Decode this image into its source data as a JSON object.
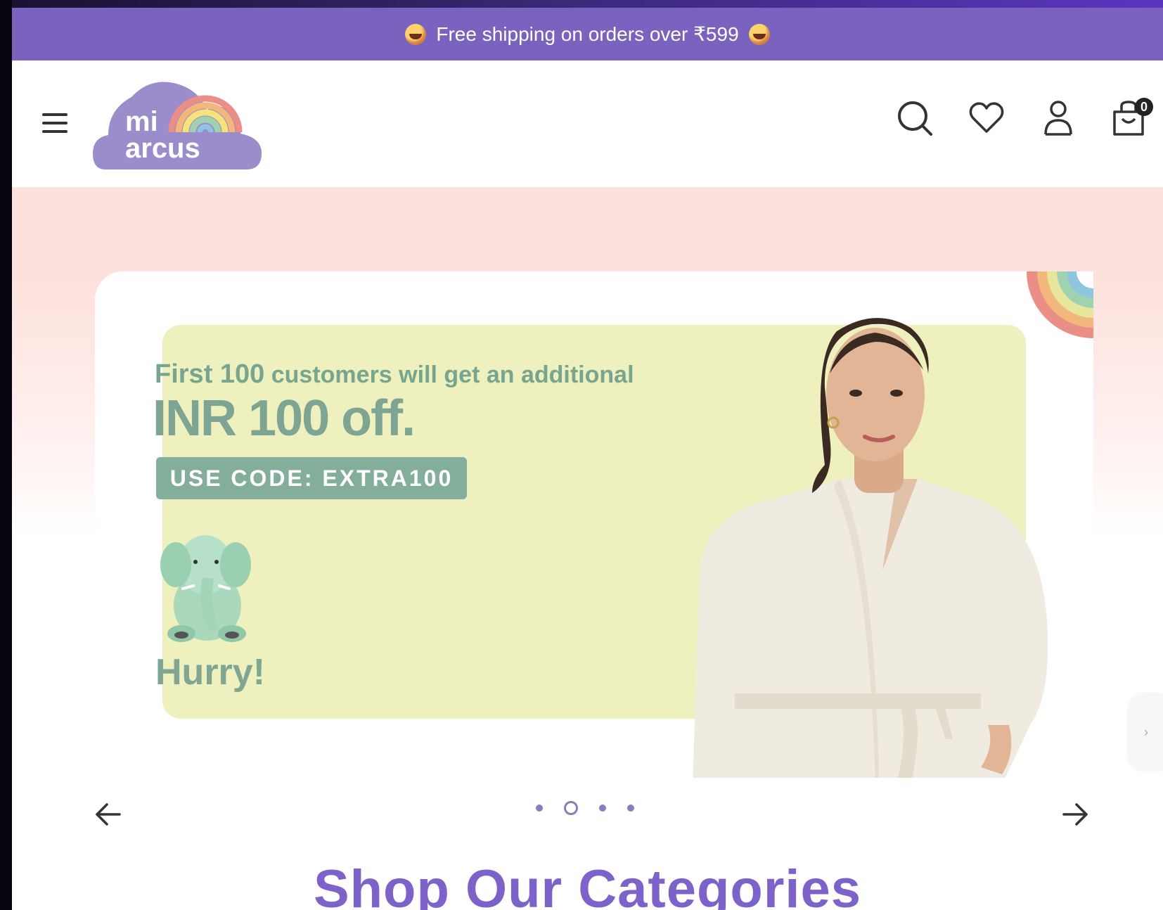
{
  "announcement": {
    "text": "Free shipping on orders over ₹599",
    "left_icon": "emoji-face-icon",
    "right_icon": "emoji-face-icon"
  },
  "header": {
    "logo_line1": "mi",
    "logo_line2": "arcus",
    "cart_count": "0",
    "icons": [
      "menu-icon",
      "search-icon",
      "heart-icon",
      "user-icon",
      "cart-icon"
    ]
  },
  "hero": {
    "line1_prefix": "First 100",
    "line1_rest": " customers will get an additional",
    "line2": "INR 100 off.",
    "code_button": "USE CODE: EXTRA100",
    "hurry": "Hurry!",
    "active_slide": 1,
    "total_slides": 4
  },
  "section": {
    "title": "Shop Our Categories"
  },
  "colors": {
    "brand_purple": "#7a63bf",
    "promo_yellow": "#eef0bd",
    "promo_green": "#84ae9c",
    "hero_pink": "#fde1dc"
  }
}
